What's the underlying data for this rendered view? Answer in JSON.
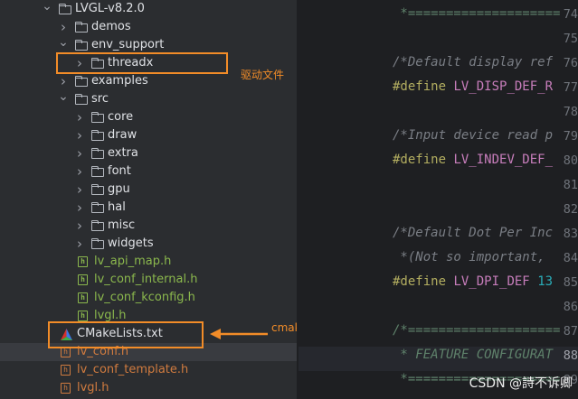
{
  "tree": {
    "items": [
      {
        "label": "LVGL-v8.2.0",
        "type": "folder",
        "expanded": true
      },
      {
        "label": "demos",
        "type": "folder",
        "expanded": false
      },
      {
        "label": "env_support",
        "type": "folder",
        "expanded": true
      },
      {
        "label": "threadx",
        "type": "folder",
        "expanded": false
      },
      {
        "label": "examples",
        "type": "folder",
        "expanded": false
      },
      {
        "label": "src",
        "type": "folder",
        "expanded": true
      },
      {
        "label": "core",
        "type": "folder",
        "expanded": false
      },
      {
        "label": "draw",
        "type": "folder",
        "expanded": false
      },
      {
        "label": "extra",
        "type": "folder",
        "expanded": false
      },
      {
        "label": "font",
        "type": "folder",
        "expanded": false
      },
      {
        "label": "gpu",
        "type": "folder",
        "expanded": false
      },
      {
        "label": "hal",
        "type": "folder",
        "expanded": false
      },
      {
        "label": "misc",
        "type": "folder",
        "expanded": false
      },
      {
        "label": "widgets",
        "type": "folder",
        "expanded": false
      },
      {
        "label": "lv_api_map.h",
        "type": "header"
      },
      {
        "label": "lv_conf_internal.h",
        "type": "header"
      },
      {
        "label": "lv_conf_kconfig.h",
        "type": "header"
      },
      {
        "label": "lvgl.h",
        "type": "header"
      },
      {
        "label": "CMakeLists.txt",
        "type": "cmake"
      },
      {
        "label": "lv_conf.h",
        "type": "header-modified"
      },
      {
        "label": "lv_conf_template.h",
        "type": "header-modified"
      },
      {
        "label": "lvgl.h",
        "type": "header-modified"
      }
    ]
  },
  "annotations": {
    "driver_label": "驱动文件",
    "cmake_label": "cmakelist管理",
    "color": "#f28c28"
  },
  "editor": {
    "lines": [
      {
        "num": "74",
        "text": " *===================="
      },
      {
        "num": "75",
        "text": ""
      },
      {
        "num": "76",
        "text": "/*Default display ref"
      },
      {
        "num": "77",
        "define": "#define",
        "name": "LV_DISP_DEF_R"
      },
      {
        "num": "78",
        "text": ""
      },
      {
        "num": "79",
        "text": "/*Input device read p"
      },
      {
        "num": "80",
        "define": "#define",
        "name": "LV_INDEV_DEF_"
      },
      {
        "num": "81",
        "text": ""
      },
      {
        "num": "82",
        "text": ""
      },
      {
        "num": "83",
        "text": "/*Default Dot Per Inc"
      },
      {
        "num": "84",
        "text": " *(Not so important, "
      },
      {
        "num": "85",
        "define": "#define",
        "name": "LV_DPI_DEF",
        "value": "13"
      },
      {
        "num": "86",
        "text": ""
      },
      {
        "num": "87",
        "text": "/*===================="
      },
      {
        "num": "88",
        "text": " * FEATURE CONFIGURAT"
      },
      {
        "num": "89",
        "text": " *===================="
      }
    ],
    "current_line": "88"
  },
  "watermark": "CSDN @詩不诉卿"
}
